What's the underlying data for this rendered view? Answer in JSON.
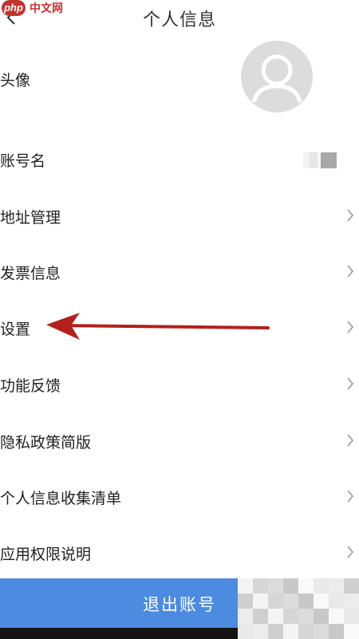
{
  "watermark": {
    "logo": "php",
    "text": "中文网"
  },
  "header": {
    "title": "个人信息"
  },
  "avatar_row": {
    "label": "头像"
  },
  "account_row": {
    "label": "账号名"
  },
  "menu": [
    {
      "label": "地址管理"
    },
    {
      "label": "发票信息"
    },
    {
      "label": "设置"
    },
    {
      "label": "功能反馈"
    },
    {
      "label": "隐私政策简版"
    },
    {
      "label": "个人信息收集清单"
    },
    {
      "label": "应用权限说明"
    }
  ],
  "logout": {
    "label": "退出账号"
  },
  "colors": {
    "accent": "#4c8be0",
    "annotation_arrow": "#b3201c",
    "watermark": "#c3332f"
  },
  "icons": {
    "back": "chevron-left-icon",
    "row": "chevron-right-icon",
    "avatar": "default-user-avatar-icon"
  }
}
